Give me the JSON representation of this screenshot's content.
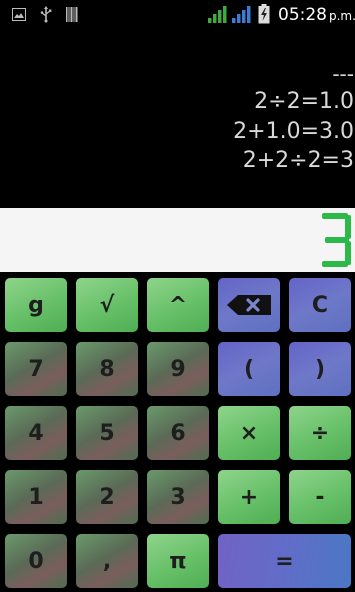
{
  "status_bar": {
    "time": "05:28",
    "ampm": "p.m.",
    "icons": [
      "picture-icon",
      "usb-icon",
      "barcode-icon",
      "signal-icon",
      "signal-icon",
      "battery-charging-icon"
    ],
    "colors": {
      "signal": "#3fa83f",
      "signal_alt": "#3a7bd5"
    }
  },
  "history": {
    "lines": [
      "---",
      "2÷2=1.0",
      "2+1.0=3.0",
      "2+2÷2=3"
    ]
  },
  "display": {
    "value": "3",
    "color": "#2db84a"
  },
  "keys": [
    {
      "label": "g",
      "name": "key-g"
    },
    {
      "label": "√",
      "name": "key-sqrt"
    },
    {
      "label": "^",
      "name": "key-power"
    },
    {
      "label": "",
      "name": "key-backspace",
      "icon": "backspace-icon"
    },
    {
      "label": "C",
      "name": "key-clear"
    },
    {
      "label": "7",
      "name": "key-7"
    },
    {
      "label": "8",
      "name": "key-8"
    },
    {
      "label": "9",
      "name": "key-9"
    },
    {
      "label": "(",
      "name": "key-open-paren"
    },
    {
      "label": ")",
      "name": "key-close-paren"
    },
    {
      "label": "4",
      "name": "key-4"
    },
    {
      "label": "5",
      "name": "key-5"
    },
    {
      "label": "6",
      "name": "key-6"
    },
    {
      "label": "×",
      "name": "key-multiply"
    },
    {
      "label": "÷",
      "name": "key-divide"
    },
    {
      "label": "1",
      "name": "key-1"
    },
    {
      "label": "2",
      "name": "key-2"
    },
    {
      "label": "3",
      "name": "key-3"
    },
    {
      "label": "+",
      "name": "key-plus"
    },
    {
      "label": "-",
      "name": "key-minus"
    },
    {
      "label": "0",
      "name": "key-0"
    },
    {
      "label": ",",
      "name": "key-comma"
    },
    {
      "label": "π",
      "name": "key-pi"
    },
    {
      "label": "=",
      "name": "key-equals"
    }
  ]
}
